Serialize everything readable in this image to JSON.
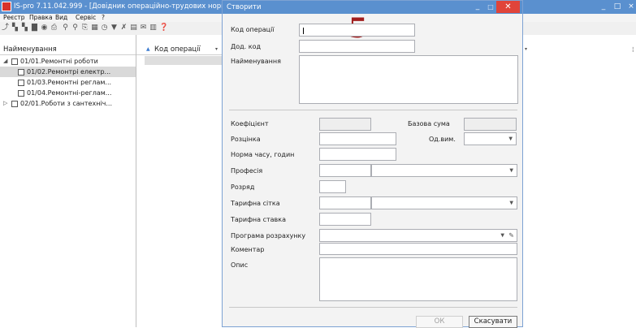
{
  "main_window": {
    "title": "IS-pro 7.11.042.999 - [Довідник операційно-трудових норма",
    "menu": [
      "Реєстр",
      "Правка",
      "Вид",
      "Сервіс",
      "?"
    ],
    "tree_header": "Найменування",
    "tree_items": [
      {
        "label": "01/01.Ремонтні роботи",
        "expander": "◢",
        "selected": false
      },
      {
        "label": "01/02.Ремонтрі електр...",
        "expander": "",
        "selected": true
      },
      {
        "label": "01/03.Ремонтні реглам...",
        "expander": "",
        "selected": false
      },
      {
        "label": "01/04.Ремонтні-реглам...",
        "expander": "",
        "selected": false
      },
      {
        "label": "02/01.Роботи з сантехніч...",
        "expander": "▷",
        "selected": false
      }
    ],
    "grid_header": "Код операції"
  },
  "dialog": {
    "title": "Створити",
    "annotation": "5",
    "fields": {
      "code_label": "Код операції",
      "code_value": "",
      "add_code_label": "Дод. код",
      "name_label": "Найменування",
      "coef_label": "Коефіцієнт",
      "base_sum_label": "Базова сума",
      "rozcinka_label": "Розцінка",
      "unit_label": "Од.вим.",
      "norm_label": "Норма часу, годин",
      "profession_label": "Професія",
      "grade_label": "Розряд",
      "tariff_grid_label": "Тарифна сітка",
      "tariff_rate_label": "Тарифна ставка",
      "program_label": "Програма розрахунку",
      "comment_label": "Коментар",
      "description_label": "Опис"
    },
    "buttons": {
      "ok": "ОК",
      "cancel": "Скасувати"
    }
  }
}
